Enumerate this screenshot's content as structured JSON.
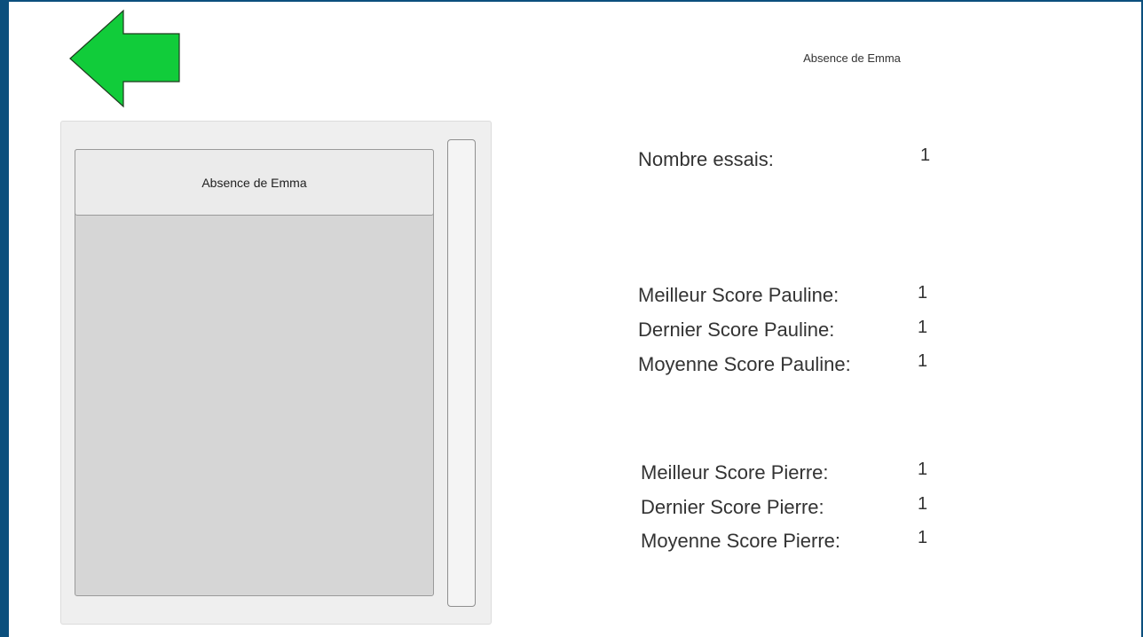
{
  "title": "Absence de Emma",
  "back_button": {
    "icon": "arrow-left-icon",
    "color": "#11cc3a"
  },
  "list": {
    "items": [
      {
        "label": "Absence de Emma"
      }
    ]
  },
  "stats": {
    "nombre_essais": {
      "label": "Nombre essais:",
      "value": "1"
    },
    "pauline": {
      "meilleur": {
        "label": "Meilleur Score Pauline:",
        "value": "1"
      },
      "dernier": {
        "label": "Dernier Score Pauline:",
        "value": "1"
      },
      "moyenne": {
        "label": "Moyenne Score Pauline:",
        "value": "1"
      }
    },
    "pierre": {
      "meilleur": {
        "label": "Meilleur Score Pierre:",
        "value": "1"
      },
      "dernier": {
        "label": "Dernier Score Pierre:",
        "value": "1"
      },
      "moyenne": {
        "label": "Moyenne Score Pierre:",
        "value": "1"
      }
    }
  }
}
